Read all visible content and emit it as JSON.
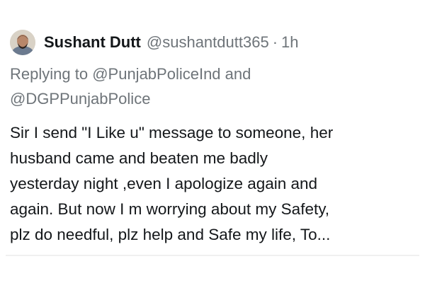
{
  "author": {
    "display_name": "Sushant Dutt",
    "handle": "@sushantdutt365",
    "separator": "·",
    "time": "1h",
    "avatar_icon": "user-avatar"
  },
  "reply": {
    "prefix": "Replying to",
    "mention_1": "@PunjabPoliceInd",
    "conjunction": "and",
    "mention_2": "@DGPPunjabPolice"
  },
  "tweet": {
    "lines": [
      "Sir I send \"I Like u\" message to someone, her",
      "husband came and beaten me badly",
      "yesterday night ,even I apologize again and",
      "again. But now I m worrying about my Safety,",
      "plz do needful, plz help and Safe my life, To..."
    ]
  },
  "colors": {
    "text_primary": "#14171a",
    "text_secondary": "#6e7479",
    "background": "#ffffff"
  }
}
